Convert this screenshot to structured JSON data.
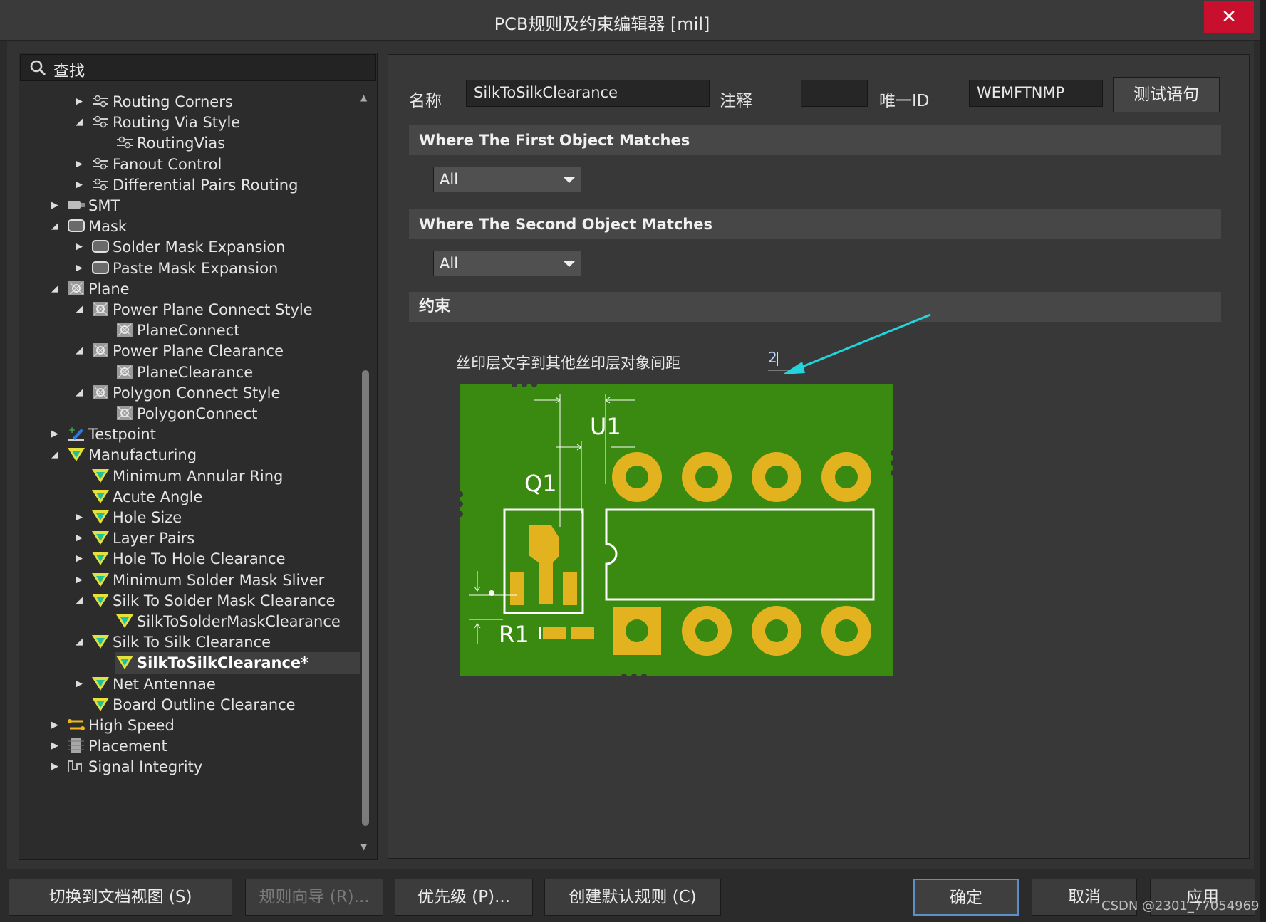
{
  "window": {
    "title": "PCB规则及约束编辑器 [mil]",
    "close_glyph": "✕"
  },
  "search": {
    "placeholder": "查找",
    "icon": "search-icon"
  },
  "tree": [
    {
      "label": "Routing Corners",
      "level": 2,
      "expander": "collapsed",
      "icon": "rule-icon"
    },
    {
      "label": "Routing Via Style",
      "level": 2,
      "expander": "expanded",
      "icon": "rule-icon"
    },
    {
      "label": "RoutingVias",
      "level": 3,
      "expander": "none",
      "icon": "rule-icon"
    },
    {
      "label": "Fanout Control",
      "level": 2,
      "expander": "collapsed",
      "icon": "rule-icon"
    },
    {
      "label": "Differential Pairs Routing",
      "level": 2,
      "expander": "collapsed",
      "icon": "rule-icon"
    },
    {
      "label": "SMT",
      "level": 1,
      "expander": "collapsed",
      "icon": "smt-icon"
    },
    {
      "label": "Mask",
      "level": 1,
      "expander": "expanded",
      "icon": "mask-icon"
    },
    {
      "label": "Solder Mask Expansion",
      "level": 2,
      "expander": "collapsed",
      "icon": "mask-icon"
    },
    {
      "label": "Paste Mask Expansion",
      "level": 2,
      "expander": "collapsed",
      "icon": "mask-icon"
    },
    {
      "label": "Plane",
      "level": 1,
      "expander": "expanded",
      "icon": "plane-icon"
    },
    {
      "label": "Power Plane Connect Style",
      "level": 2,
      "expander": "expanded",
      "icon": "plane-icon"
    },
    {
      "label": "PlaneConnect",
      "level": 3,
      "expander": "none",
      "icon": "plane-icon"
    },
    {
      "label": "Power Plane Clearance",
      "level": 2,
      "expander": "expanded",
      "icon": "plane-icon"
    },
    {
      "label": "PlaneClearance",
      "level": 3,
      "expander": "none",
      "icon": "plane-icon"
    },
    {
      "label": "Polygon Connect Style",
      "level": 2,
      "expander": "expanded",
      "icon": "plane-icon"
    },
    {
      "label": "PolygonConnect",
      "level": 3,
      "expander": "none",
      "icon": "plane-icon"
    },
    {
      "label": "Testpoint",
      "level": 1,
      "expander": "collapsed",
      "icon": "testpoint-icon"
    },
    {
      "label": "Manufacturing",
      "level": 1,
      "expander": "expanded",
      "icon": "manufacturing-icon"
    },
    {
      "label": "Minimum Annular Ring",
      "level": 2,
      "expander": "none",
      "icon": "manufacturing-icon"
    },
    {
      "label": "Acute Angle",
      "level": 2,
      "expander": "none",
      "icon": "manufacturing-icon"
    },
    {
      "label": "Hole Size",
      "level": 2,
      "expander": "collapsed",
      "icon": "manufacturing-icon"
    },
    {
      "label": "Layer Pairs",
      "level": 2,
      "expander": "collapsed",
      "icon": "manufacturing-icon"
    },
    {
      "label": "Hole To Hole Clearance",
      "level": 2,
      "expander": "collapsed",
      "icon": "manufacturing-icon"
    },
    {
      "label": "Minimum Solder Mask Sliver",
      "level": 2,
      "expander": "collapsed",
      "icon": "manufacturing-icon"
    },
    {
      "label": "Silk To Solder Mask Clearance",
      "level": 2,
      "expander": "expanded",
      "icon": "manufacturing-icon"
    },
    {
      "label": "SilkToSolderMaskClearance",
      "level": 3,
      "expander": "none",
      "icon": "manufacturing-icon"
    },
    {
      "label": "Silk To Silk Clearance",
      "level": 2,
      "expander": "expanded",
      "icon": "manufacturing-icon"
    },
    {
      "label": "SilkToSilkClearance*",
      "level": 3,
      "expander": "none",
      "icon": "manufacturing-icon",
      "selected": true
    },
    {
      "label": "Net Antennae",
      "level": 2,
      "expander": "collapsed",
      "icon": "manufacturing-icon"
    },
    {
      "label": "Board Outline Clearance",
      "level": 2,
      "expander": "none",
      "icon": "manufacturing-icon"
    },
    {
      "label": "High Speed",
      "level": 1,
      "expander": "collapsed",
      "icon": "highspeed-icon"
    },
    {
      "label": "Placement",
      "level": 1,
      "expander": "collapsed",
      "icon": "placement-icon"
    },
    {
      "label": "Signal Integrity",
      "level": 1,
      "expander": "collapsed",
      "icon": "signal-integrity-icon"
    }
  ],
  "rule": {
    "name_label": "名称",
    "name_value": "SilkToSilkClearance",
    "comment_label": "注释",
    "comment_value": "",
    "uid_label": "唯一ID",
    "uid_value": "WEMFTNMP",
    "test_button": "测试语句"
  },
  "first_match": {
    "title": "Where The First Object Matches",
    "value": "All"
  },
  "second_match": {
    "title": "Where The Second Object Matches",
    "value": "All"
  },
  "constraints": {
    "title": "约束",
    "description": "丝印层文字到其他丝印层对象间距",
    "value": "2"
  },
  "diagram": {
    "labels": [
      "U1",
      "Q1",
      "R1"
    ],
    "colors": {
      "board": "#3a8a12",
      "pad": "#e3b21f",
      "silk": "#ffffff",
      "arrow": "#22d4dc"
    }
  },
  "bottom_buttons": {
    "switch_view": "切换到文档视图 (S)",
    "rule_wizard": "规则向导 (R)...",
    "priority": "优先级 (P)...",
    "create_default": "创建默认规则 (C)",
    "ok": "确定",
    "cancel": "取消",
    "apply": "应用"
  },
  "watermark": "CSDN @2301_77054969"
}
